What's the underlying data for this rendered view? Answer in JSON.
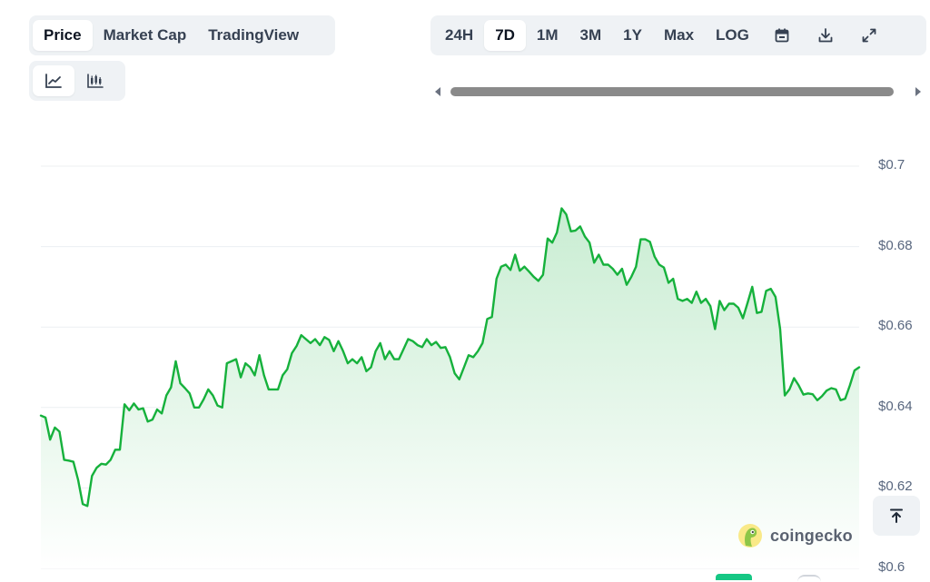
{
  "metric_tabs": [
    {
      "label": "Price",
      "active": true
    },
    {
      "label": "Market Cap",
      "active": false
    },
    {
      "label": "TradingView",
      "active": false
    }
  ],
  "chart_type_tabs": [
    {
      "icon": "line-chart-icon",
      "active": true
    },
    {
      "icon": "candlestick-chart-icon",
      "active": false
    }
  ],
  "range_tabs": [
    {
      "label": "24H",
      "active": false
    },
    {
      "label": "7D",
      "active": true
    },
    {
      "label": "1M",
      "active": false
    },
    {
      "label": "3M",
      "active": false
    },
    {
      "label": "1Y",
      "active": false
    },
    {
      "label": "Max",
      "active": false
    },
    {
      "label": "LOG",
      "active": false
    }
  ],
  "toolbar_icons": [
    "calendar-icon",
    "download-icon",
    "fullscreen-icon"
  ],
  "watermark": {
    "text": "coingecko"
  },
  "colors": {
    "line": "#16b13c",
    "fill_top": "#c6ecd0",
    "fill_bottom": "#ffffff",
    "grid": "#eceff2",
    "accent": "#8dc647"
  },
  "chart_data": {
    "type": "area",
    "ylim": [
      0.6,
      0.7
    ],
    "yticks": [
      {
        "value": 0.7,
        "label": "$0.7"
      },
      {
        "value": 0.68,
        "label": "$0.68"
      },
      {
        "value": 0.66,
        "label": "$0.66"
      },
      {
        "value": 0.64,
        "label": "$0.64"
      },
      {
        "value": 0.62,
        "label": "$0.62"
      },
      {
        "value": 0.6,
        "label": "$0.6"
      }
    ],
    "grid": true,
    "series": [
      {
        "values": [
          0.638,
          0.6375,
          0.632,
          0.635,
          0.634,
          0.627,
          0.6268,
          0.6265,
          0.622,
          0.616,
          0.6155,
          0.623,
          0.625,
          0.626,
          0.6258,
          0.627,
          0.6295,
          0.6295,
          0.6408,
          0.6393,
          0.641,
          0.6395,
          0.6398,
          0.6365,
          0.637,
          0.6395,
          0.6385,
          0.643,
          0.645,
          0.6515,
          0.646,
          0.6448,
          0.6435,
          0.64,
          0.64,
          0.642,
          0.6445,
          0.643,
          0.6405,
          0.64,
          0.651,
          0.6515,
          0.652,
          0.6475,
          0.651,
          0.65,
          0.648,
          0.653,
          0.648,
          0.6445,
          0.6445,
          0.6445,
          0.648,
          0.6495,
          0.6535,
          0.6553,
          0.658,
          0.657,
          0.656,
          0.657,
          0.6555,
          0.6575,
          0.6568,
          0.654,
          0.6565,
          0.654,
          0.651,
          0.652,
          0.651,
          0.6525,
          0.649,
          0.65,
          0.654,
          0.656,
          0.652,
          0.654,
          0.652,
          0.652,
          0.6545,
          0.657,
          0.6565,
          0.6555,
          0.655,
          0.657,
          0.6555,
          0.6563,
          0.6548,
          0.655,
          0.6525,
          0.6485,
          0.647,
          0.65,
          0.653,
          0.6525,
          0.654,
          0.656,
          0.662,
          0.6625,
          0.672,
          0.675,
          0.6755,
          0.6742,
          0.678,
          0.674,
          0.675,
          0.6738,
          0.6725,
          0.6715,
          0.673,
          0.682,
          0.681,
          0.6835,
          0.6895,
          0.688,
          0.6838,
          0.684,
          0.685,
          0.6825,
          0.681,
          0.676,
          0.678,
          0.6755,
          0.6755,
          0.6745,
          0.673,
          0.6745,
          0.6705,
          0.6725,
          0.675,
          0.6818,
          0.6818,
          0.6812,
          0.6775,
          0.6755,
          0.6748,
          0.671,
          0.672,
          0.667,
          0.6665,
          0.667,
          0.666,
          0.6688,
          0.666,
          0.667,
          0.6652,
          0.6595,
          0.6665,
          0.6642,
          0.6658,
          0.6658,
          0.6648,
          0.6622,
          0.666,
          0.67,
          0.6635,
          0.6638,
          0.669,
          0.6695,
          0.6675,
          0.6595,
          0.643,
          0.6445,
          0.6473,
          0.6455,
          0.6432,
          0.6435,
          0.6433,
          0.6418,
          0.6428,
          0.6442,
          0.6448,
          0.6445,
          0.6418,
          0.6422,
          0.6455,
          0.6492,
          0.65
        ]
      }
    ]
  }
}
